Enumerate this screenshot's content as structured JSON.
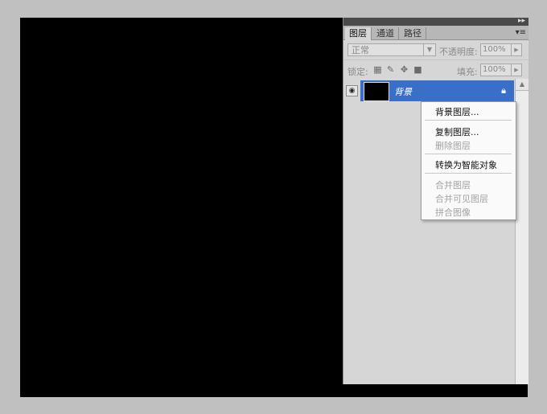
{
  "panel": {
    "collapse_icon": "double-chevron-right",
    "tabs": [
      {
        "label": "图层",
        "active": true
      },
      {
        "label": "通道",
        "active": false
      },
      {
        "label": "路径",
        "active": false
      }
    ],
    "menu_icon": "▾≡",
    "blend_mode": "正常",
    "opacity_label": "不透明度:",
    "opacity_value": "100%",
    "lock_label": "锁定:",
    "fill_label": "填充:",
    "fill_value": "100%"
  },
  "layer": {
    "name": "背景",
    "visible": true
  },
  "context_menu": {
    "items": [
      {
        "label": "背景图层...",
        "enabled": true
      },
      {
        "label": "复制图层...",
        "enabled": true
      },
      {
        "label": "删除图层",
        "enabled": false
      },
      {
        "label": "转换为智能对象",
        "enabled": true
      },
      {
        "label": "合并图层",
        "enabled": false
      },
      {
        "label": "合并可见图层",
        "enabled": false
      },
      {
        "label": "拼合图像",
        "enabled": false
      }
    ]
  },
  "colors": {
    "canvas": "#000000",
    "selection": "#3a6fc9",
    "panel_bg": "#d6d6d6",
    "page_bg": "#c0c0c0"
  }
}
